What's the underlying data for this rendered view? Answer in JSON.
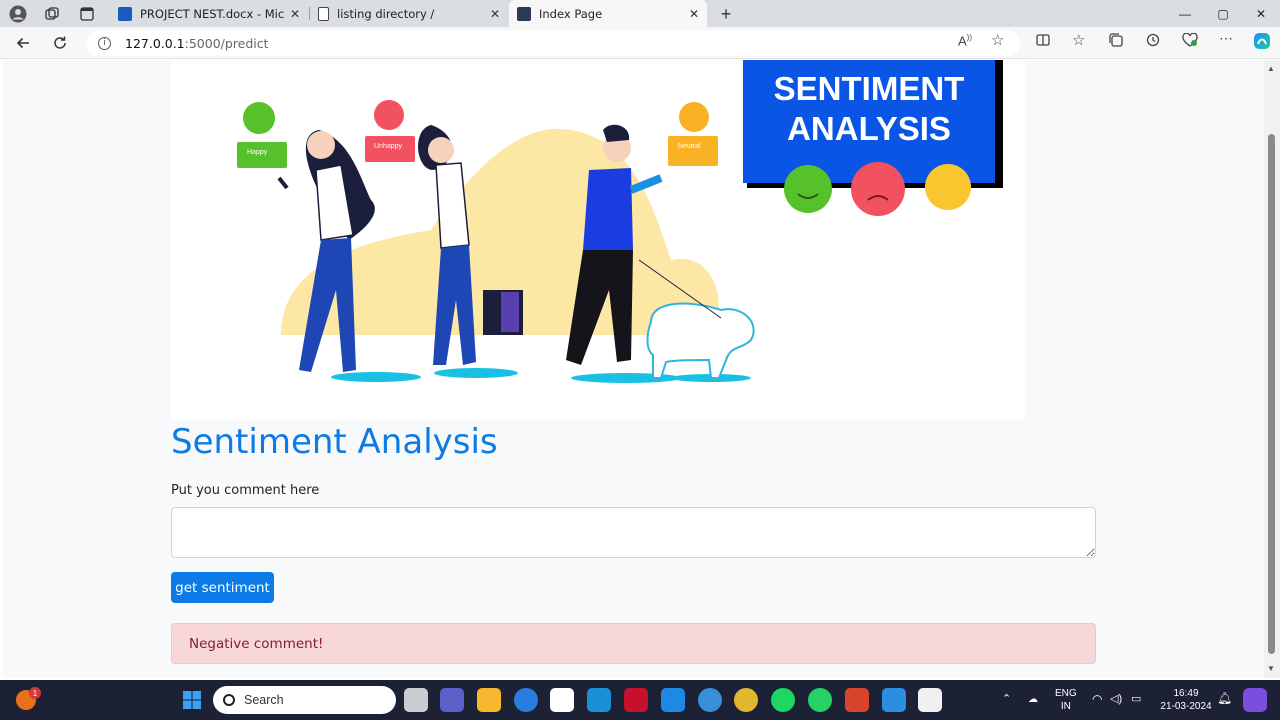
{
  "tabs": [
    {
      "title": "PROJECT NEST.docx - Microsoft W",
      "icon": "word-icon"
    },
    {
      "title": "listing directory /",
      "icon": "document-icon"
    },
    {
      "title": "Index Page",
      "icon": "terminal-icon"
    }
  ],
  "address": {
    "host": "127.0.0.1",
    "path": ":5000/predict"
  },
  "banner": {
    "title_line1": "SENTIMENT",
    "title_line2": "ANALYSIS",
    "bubbles": [
      "Happy",
      "Unhappy",
      "Neutral"
    ]
  },
  "main": {
    "heading": "Sentiment Analysis",
    "comment_label": "Put you comment here",
    "comment_value": "",
    "submit_label": "get sentiment",
    "result": "Negative comment!"
  },
  "taskbar": {
    "search_placeholder": "Search",
    "notification_badge": "1",
    "language": "ENG",
    "region": "IN",
    "time": "16:49",
    "date": "21-03-2024"
  },
  "colors": {
    "accent": "#0d7be6",
    "alert_bg": "#f8d7da",
    "alert_text": "#842029",
    "taskbar_bg": "#1d2136"
  }
}
